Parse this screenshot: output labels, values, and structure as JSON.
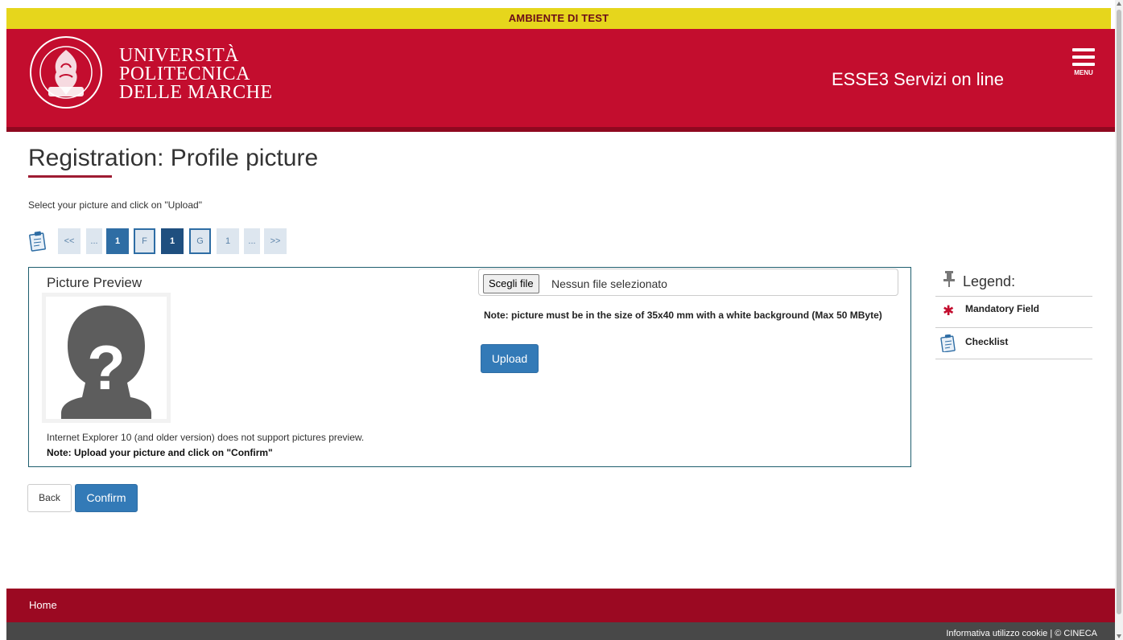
{
  "banner": {
    "text": "AMBIENTE DI TEST"
  },
  "header": {
    "university_lines": [
      "UNIVERSITÀ",
      "POLITECNICA",
      "DELLE MARCHE"
    ],
    "seal_text": "UNIVERSITÀ POLITECNICA DELLE MARCHE",
    "service_title": "ESSE3 Servizi on line",
    "menu_label": "MENU"
  },
  "page": {
    "title": "Registration: Profile picture",
    "instructions": "Select your picture and click on \"Upload\""
  },
  "stepper": {
    "steps": [
      {
        "label": "<<"
      },
      {
        "label": "..."
      },
      {
        "label": "1"
      },
      {
        "label": "F"
      },
      {
        "label": "1"
      },
      {
        "label": "G"
      },
      {
        "label": "1"
      },
      {
        "label": "..."
      },
      {
        "label": ">>"
      }
    ]
  },
  "preview": {
    "title": "Picture Preview",
    "ie_note": "Internet Explorer 10 (and older version) does not support pictures preview.",
    "upload_note": "Note: Upload your picture and click on \"Confirm\""
  },
  "upload": {
    "choose_file_label": "Scegli file",
    "file_status": "Nessun file selezionato",
    "size_note": "Note: picture must be in the size of 35x40 mm with a white background (Max 50 MByte)",
    "upload_label": "Upload"
  },
  "legend": {
    "title": "Legend:",
    "items": [
      {
        "label": "Mandatory Field",
        "icon": "asterisk-icon"
      },
      {
        "label": "Checklist",
        "icon": "clipboard-icon"
      }
    ]
  },
  "actions": {
    "back_label": "Back",
    "confirm_label": "Confirm"
  },
  "footer": {
    "home_label": "Home",
    "credits": "Informativa utilizzo cookie | © CINECA"
  },
  "colors": {
    "brand_red": "#c30d2e",
    "footer_red": "#9b0922",
    "banner_yellow": "#e6d61c",
    "primary_blue": "#337ab7",
    "footer_gray": "#484848"
  }
}
